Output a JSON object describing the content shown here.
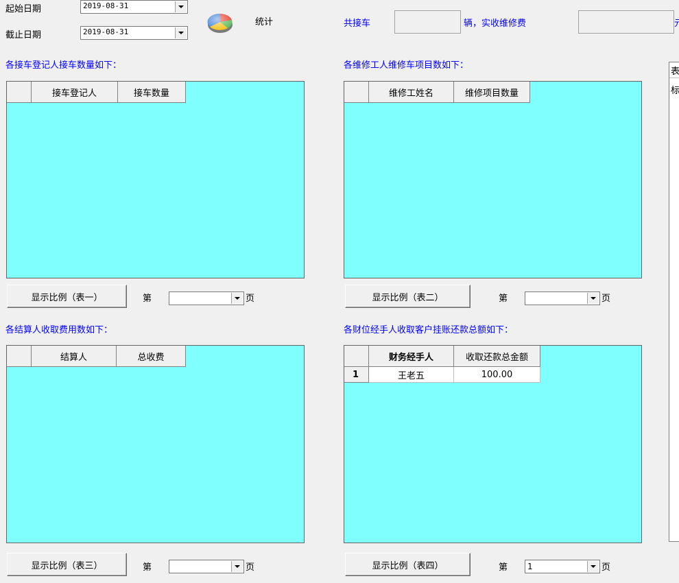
{
  "top": {
    "start_label": "起始日期",
    "start_value": "2019-08-31",
    "end_label": "截止日期",
    "end_value": "2019-08-31",
    "stats_label": "统计",
    "total_cars_label": "共接车",
    "total_cars_value": "",
    "fee_label": "辆，实收维修费",
    "fee_value": "",
    "yuan_label": "元"
  },
  "side": {
    "line1": "表",
    "line2": "标"
  },
  "colors": {
    "grid_bg": "#80ffff",
    "label_blue": "#0000ff"
  },
  "panels": [
    {
      "title": "各接车登记人接车数量如下：",
      "headers": [
        "接车登记人",
        "接车数量"
      ],
      "rows": [],
      "button": "显示比例（表一）",
      "page_prefix": "第",
      "page_value": "",
      "page_suffix": "页"
    },
    {
      "title": "各维修工人维修车项目数如下：",
      "headers": [
        "维修工姓名",
        "维修项目数量"
      ],
      "rows": [],
      "button": "显示比例（表二）",
      "page_prefix": "第",
      "page_value": "",
      "page_suffix": "页"
    },
    {
      "title": "各结算人收取费用数如下：",
      "headers": [
        "结算人",
        "总收费"
      ],
      "rows": [],
      "button": "显示比例（表三）",
      "page_prefix": "第",
      "page_value": "",
      "page_suffix": "页"
    },
    {
      "title": "各财位经手人收取客户挂账还款总额如下：",
      "headers": [
        "财务经手人",
        "收取还款总金额"
      ],
      "rows": [
        {
          "num": "1",
          "cells": [
            "王老五",
            "100.00"
          ]
        }
      ],
      "button": "显示比例（表四）",
      "page_prefix": "第",
      "page_value": "1",
      "page_suffix": "页"
    }
  ]
}
